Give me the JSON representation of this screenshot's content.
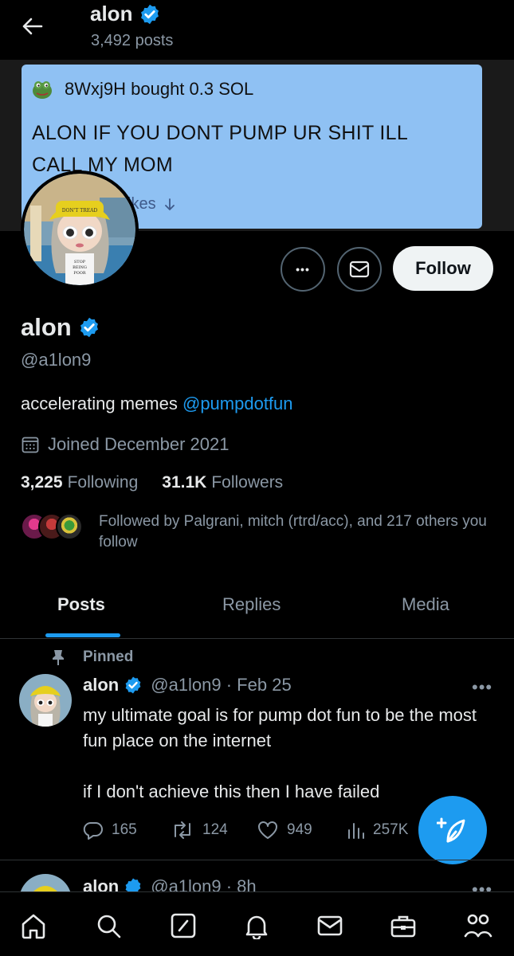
{
  "header": {
    "name": "alon",
    "posts_count": "3,492 posts"
  },
  "banner": {
    "buyer_line": "8Wxj9H bought 0.3 SOL",
    "message": "ALON IF YOU DONT PUMP UR SHIT ILL CALL MY MOM",
    "likes_label": "ikes"
  },
  "avatar": {
    "hat_text": "DON'T TREAD",
    "shirt_text_1": "STOP",
    "shirt_text_2": "BEING",
    "shirt_text_3": "POOR"
  },
  "actions": {
    "more": "•••",
    "follow": "Follow"
  },
  "profile": {
    "name": "alon",
    "handle": "@a1lon9",
    "bio_text": "accelerating memes ",
    "bio_link": "@pumpdotfun",
    "joined": "Joined December 2021",
    "following_count": "3,225",
    "following_label": "Following",
    "followers_count": "31.1K",
    "followers_label": "Followers",
    "followed_by": "Followed by Palgrani, mitch (rtrd/acc), and 217 others you follow"
  },
  "tabs": [
    {
      "label": "Posts",
      "active": true
    },
    {
      "label": "Replies",
      "active": false
    },
    {
      "label": "Media",
      "active": false
    }
  ],
  "pinned_post": {
    "pinned_label": "Pinned",
    "name": "alon",
    "handle_time": "@a1lon9 · Feb 25",
    "more": "•••",
    "line1": "my ultimate goal is for pump dot fun to be the most fun place on the internet",
    "line2": "if I don't achieve this then I have failed",
    "replies": "165",
    "reposts": "124",
    "likes": "949",
    "views": "257K"
  },
  "next_post": {
    "name": "alon",
    "handle_time": "@a1lon9 · 8h",
    "more": "•••"
  },
  "colors": {
    "accent": "#1d9bf0",
    "background": "#000000",
    "muted": "#8b98a5",
    "banner_card": "#8fc1f3"
  },
  "icons": [
    "back-arrow-icon",
    "verified-badge-icon",
    "frog-icon",
    "mail-icon",
    "calendar-icon",
    "pin-icon",
    "reply-icon",
    "repost-icon",
    "like-icon",
    "views-icon",
    "compose-icon",
    "home-icon",
    "search-icon",
    "grok-icon",
    "notifications-icon",
    "messages-icon",
    "jobs-icon",
    "communities-icon"
  ]
}
